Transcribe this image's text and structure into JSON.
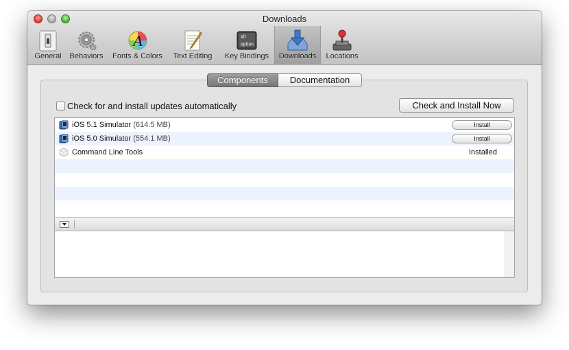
{
  "window": {
    "title": "Downloads"
  },
  "toolbar": {
    "items": [
      {
        "label": "General",
        "icon": "switch-icon"
      },
      {
        "label": "Behaviors",
        "icon": "gears-icon"
      },
      {
        "label": "Fonts & Colors",
        "icon": "font-palette-icon"
      },
      {
        "label": "Text Editing",
        "icon": "notepad-icon"
      },
      {
        "label": "Key Bindings",
        "icon": "keyboard-keys-icon",
        "key_top": "alt",
        "key_bottom": "option"
      },
      {
        "label": "Downloads",
        "icon": "download-icon",
        "selected": true
      },
      {
        "label": "Locations",
        "icon": "joystick-icon"
      }
    ]
  },
  "tabs": [
    {
      "label": "Components",
      "selected": true
    },
    {
      "label": "Documentation",
      "selected": false
    }
  ],
  "auto_update": {
    "label": "Check for and install updates automatically",
    "checked": false
  },
  "check_button": {
    "label": "Check and Install Now"
  },
  "components": [
    {
      "name": "iOS 5.1 Simulator",
      "size": "(614.5 MB)",
      "action": "Install",
      "icon": "ios-simulator-icon"
    },
    {
      "name": "iOS 5.0 Simulator",
      "size": "(554.1 MB)",
      "action": "Install",
      "icon": "ios-simulator-icon"
    },
    {
      "name": "Command Line Tools",
      "size": "",
      "status": "Installed",
      "icon": "terminal-package-icon"
    }
  ],
  "colors": {
    "accent_row": "#edf3fe",
    "selected_tab": "#8a8a8a"
  }
}
